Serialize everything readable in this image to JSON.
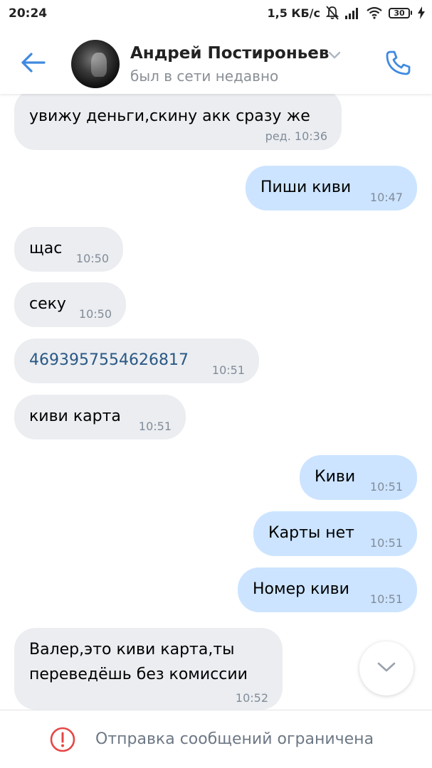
{
  "status_bar": {
    "time": "20:24",
    "speed": "1,5 КБ/с",
    "battery": "30",
    "icons": [
      "mute-bell-icon",
      "signal-icon",
      "wifi-icon",
      "battery-icon",
      "charging-icon"
    ]
  },
  "header": {
    "name": "Андрей Постироньев",
    "status": "был в сети недавно",
    "icons": [
      "back-arrow-icon",
      "avatar",
      "chevron-down-icon",
      "phone-icon"
    ],
    "accent_color": "#3f8ae0"
  },
  "messages": [
    {
      "dir": "in",
      "text": "увижу деньги,скину акк сразу же",
      "time": "ред. 10:36"
    },
    {
      "dir": "out",
      "text": "Пиши киви",
      "time": "10:47"
    },
    {
      "dir": "in",
      "text": "щас",
      "time": "10:50"
    },
    {
      "dir": "in",
      "text": "секу",
      "time": "10:50"
    },
    {
      "dir": "in",
      "text": "4693957554626817",
      "time": "10:51"
    },
    {
      "dir": "in",
      "text": "киви карта",
      "time": "10:51"
    },
    {
      "dir": "out",
      "text": "Киви",
      "time": "10:51"
    },
    {
      "dir": "out",
      "text": "Карты нет",
      "time": "10:51"
    },
    {
      "dir": "out",
      "text": "Номер киви",
      "time": "10:51"
    },
    {
      "dir": "in",
      "text_line1": "Валер,это киви карта,ты",
      "text_line2": "переведёшь без комиссии",
      "time": "10:52"
    }
  ],
  "colors": {
    "incoming_bubble": "#ebedf0",
    "outgoing_bubble": "#cce4ff",
    "link": "#2a5885",
    "warning": "#e64646"
  },
  "bottom_bar": {
    "text": "Отправка сообщений ограничена",
    "icon": "warning-circle-icon"
  },
  "scroll_button": {
    "icon": "chevron-down-icon"
  }
}
